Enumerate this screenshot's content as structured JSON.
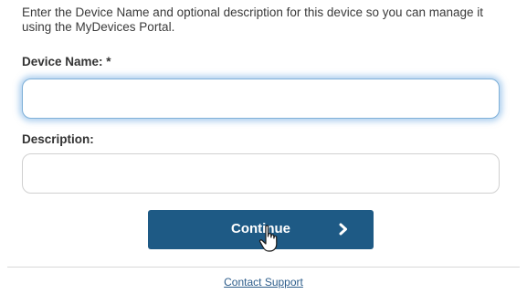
{
  "form": {
    "instructions": "Enter the Device Name and optional description for this device so you can manage it using the MyDevices Portal.",
    "device_name_label": "Device Name: *",
    "device_name_value": "",
    "description_label": "Description:",
    "description_value": "",
    "continue_label": "Continue",
    "continue_icon": "chevron-right-icon"
  },
  "footer": {
    "support_link": "Contact Support"
  },
  "colors": {
    "button_background": "#1e5a85",
    "focus_glow": "#6eaae1",
    "link": "#2d5d8b"
  }
}
